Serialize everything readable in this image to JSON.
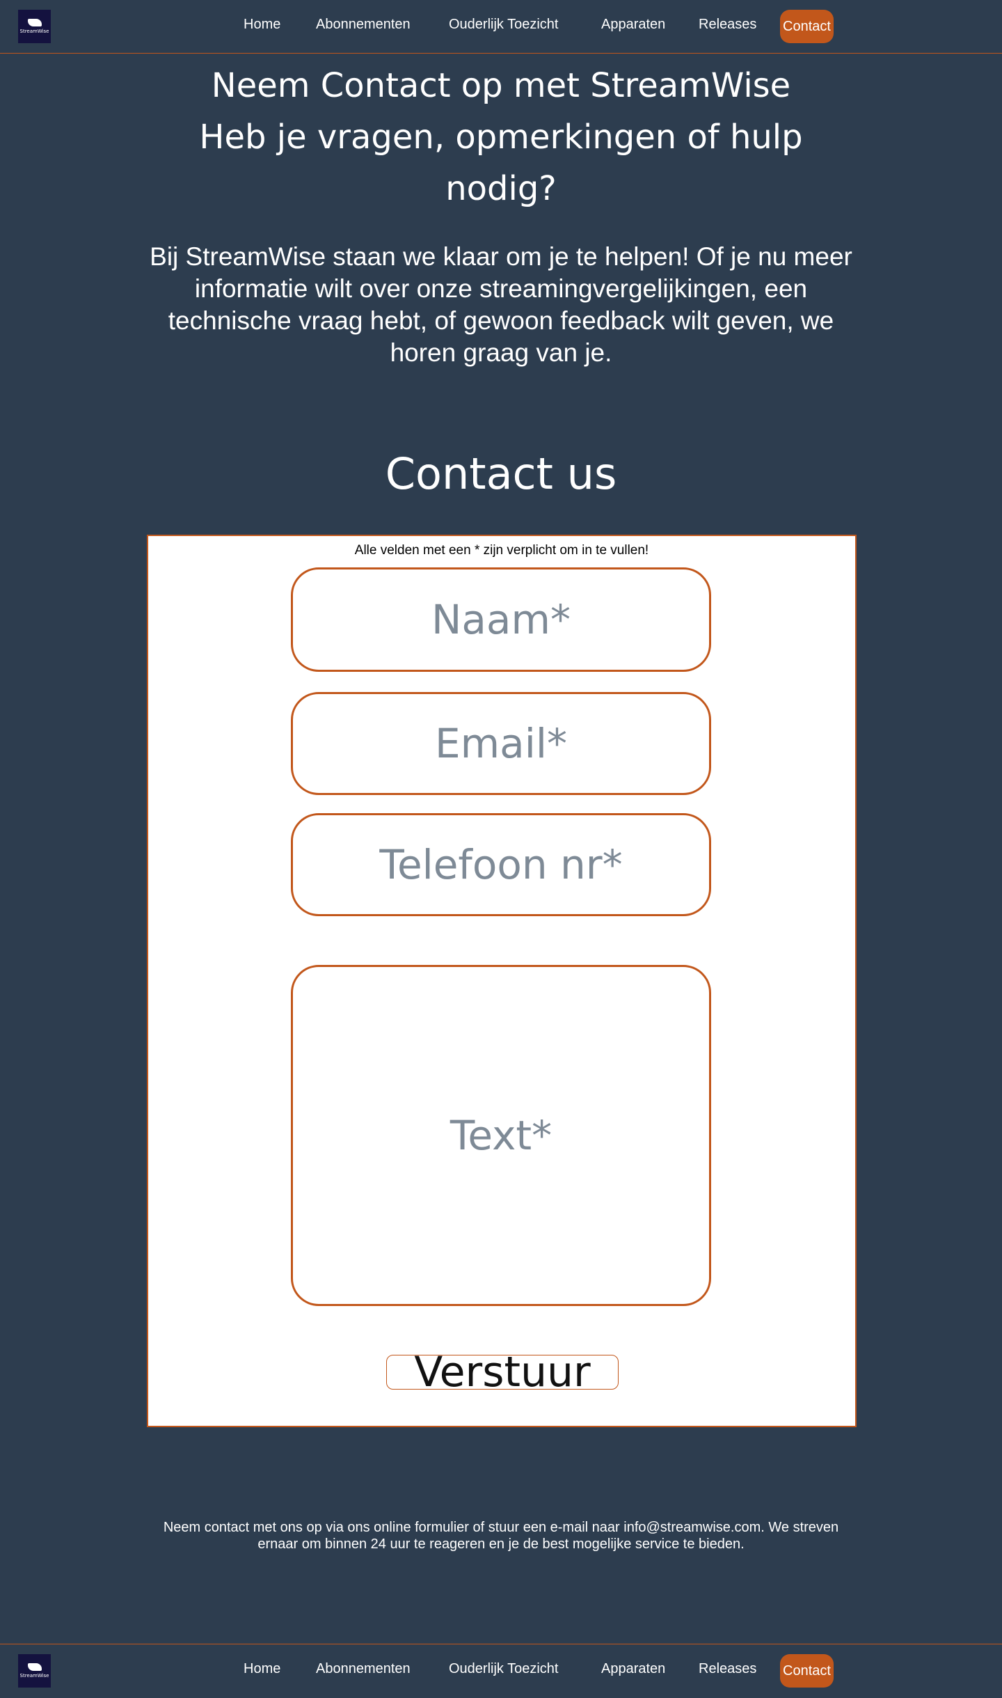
{
  "colors": {
    "background": "#2d3d4f",
    "accent": "#c2571b",
    "form_background": "#ffffff",
    "logo_background": "#14123f"
  },
  "nav": {
    "logo_text": "StreamWise",
    "items": [
      "Home",
      "Abonnementen",
      "Ouderlijk Toezicht",
      "Apparaten",
      "Releases"
    ],
    "contact_label": "Contact"
  },
  "hero": {
    "title_line1": "Neem Contact op met StreamWise",
    "title_line2": "Heb je vragen, opmerkingen of hulp",
    "title_line3": "nodig?",
    "intro": "Bij StreamWise staan we klaar om je te helpen! Of je nu meer informatie wilt over onze streamingvergelijkingen, een technische vraag hebt, of gewoon feedback wilt geven, we horen graag van je."
  },
  "contact": {
    "heading": "Contact us",
    "required_note": "Alle velden met een * zijn verplicht om in te vullen!",
    "fields": {
      "name_placeholder": "Naam*",
      "email_placeholder": "Email*",
      "phone_placeholder": "Telefoon nr*",
      "text_placeholder": "Text*"
    },
    "submit_label": "Verstuur"
  },
  "footer": {
    "text": "Neem contact met ons op via ons online formulier of stuur een e-mail naar info@streamwise.com. We streven ernaar om binnen 24 uur te reageren en je de best mogelijke service te bieden."
  }
}
